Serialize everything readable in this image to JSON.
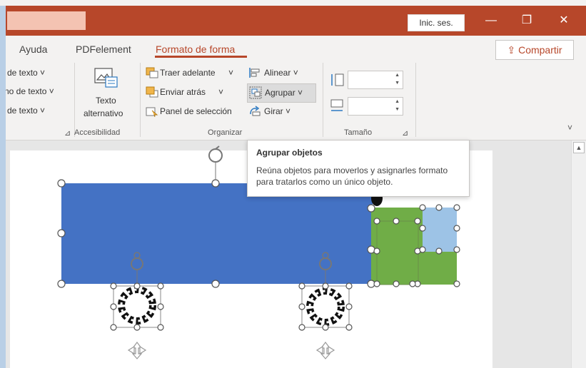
{
  "window": {
    "sign_in": "Inic. ses.",
    "minimize_glyph": "—",
    "restore_glyph": "❐",
    "close_glyph": "✕"
  },
  "tabs": {
    "help": "Ayuda",
    "pdfelement": "PDFelement",
    "shape_format": "Formato de forma"
  },
  "share_label": "Compartir",
  "ribbon": {
    "wordart": {
      "text_fill": "de texto ˅",
      "text_outline": "no de texto ˅",
      "text_effects": "de texto ˅"
    },
    "accessibility": {
      "alt_text_line1": "Texto",
      "alt_text_line2": "alternativo",
      "group_label": "Accesibilidad"
    },
    "arrange": {
      "bring_forward": "Traer adelante",
      "send_backward": "Enviar atrás",
      "selection_pane": "Panel de selección",
      "align": "Alinear ˅",
      "group": "Agrupar ˅",
      "rotate": "Girar ˅",
      "group_label": "Organizar"
    },
    "size": {
      "group_label": "Tamaño",
      "height_value": "",
      "width_value": ""
    }
  },
  "tooltip": {
    "title": "Agrupar objetos",
    "description": "Reúna objetos para moverlos y asignarles formato para tratarlos como un único objeto."
  },
  "colors": {
    "accent": "#b7472a",
    "blue_rect": "#4472c4",
    "green_shape": "#70ad47",
    "light_blue": "#9dc3e6"
  }
}
